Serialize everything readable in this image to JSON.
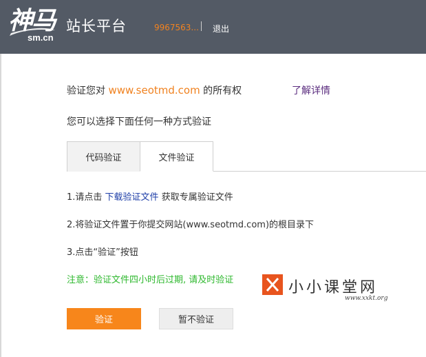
{
  "header": {
    "logo_text": "神马",
    "logo_domain": "sm.cn",
    "platform_title": "站长平台",
    "user_id": "9967563...",
    "logout_label": "退出"
  },
  "verify": {
    "prefix": "验证您对",
    "domain": "www.seotmd.com",
    "suffix": "的所有权",
    "learn_more": "了解详情",
    "choose_method": "您可以选择下面任何一种方式验证"
  },
  "tabs": [
    {
      "label": "代码验证",
      "active": false
    },
    {
      "label": "文件验证",
      "active": true
    }
  ],
  "steps": {
    "step1_prefix": "1.请点击",
    "step1_link": "下载验证文件",
    "step1_suffix": "获取专属验证文件",
    "step2": "2.将验证文件置于你提交网站(www.seotmd.com)的根目录下",
    "step3": "3.点击“验证”按钮"
  },
  "notice": "注意：验证文件四小时后过期, 请及时验证",
  "watermark": {
    "text": "小小课堂网",
    "url": "www.xxkt.org"
  },
  "buttons": {
    "verify": "验证",
    "skip": "暂不验证"
  },
  "colors": {
    "header_bg": "#535a65",
    "accent_orange": "#f08220",
    "button_orange": "#f7861b",
    "notice_green": "#2eb82e",
    "link_blue": "#1f3fa8",
    "link_purple": "#5b2d7f"
  }
}
